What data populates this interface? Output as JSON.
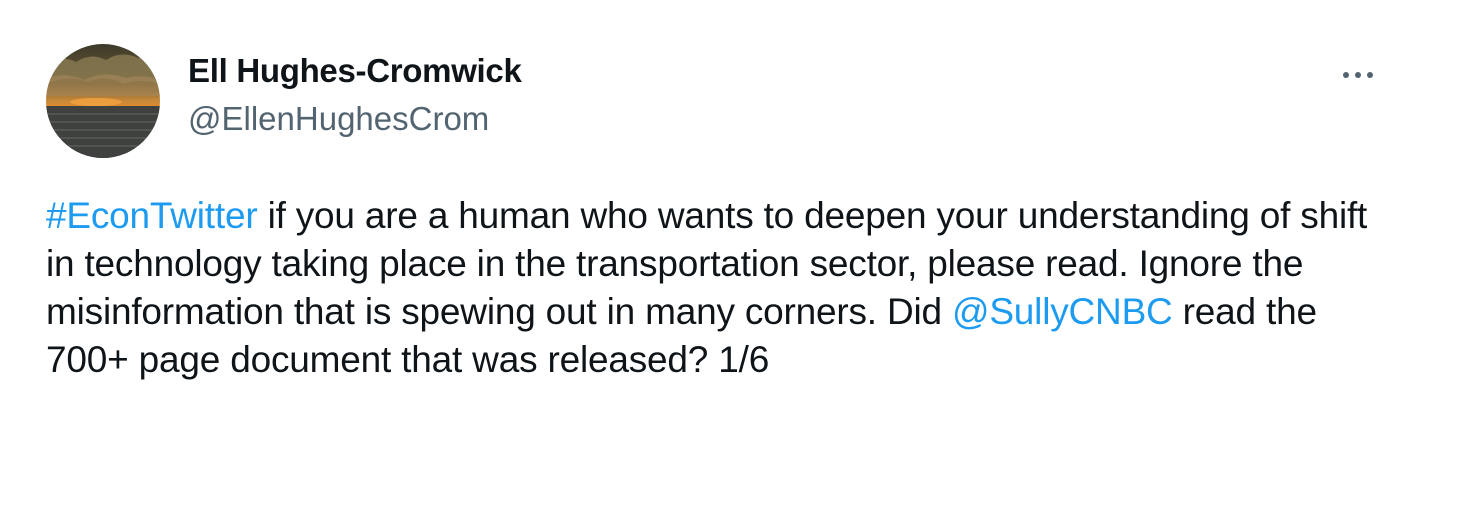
{
  "author": {
    "display_name": "Ell Hughes-Cromwick",
    "handle": "@EllenHughesCrom",
    "avatar_icon": "sunset-over-water-avatar"
  },
  "menu": {
    "icon": "more-options-icon"
  },
  "tweet": {
    "hashtag": "#EconTwitter",
    "text_part1": " if you are a human who wants to deepen your understanding of shift in technology taking place in the transportation sector, please read. Ignore the misinformation that is spewing out in many corners. Did ",
    "mention": "@SullyCNBC",
    "text_part2": " read the 700+ page document that was released? 1/6"
  },
  "colors": {
    "link": "#1d9bf0",
    "text": "#0f1419",
    "secondary": "#536471"
  }
}
